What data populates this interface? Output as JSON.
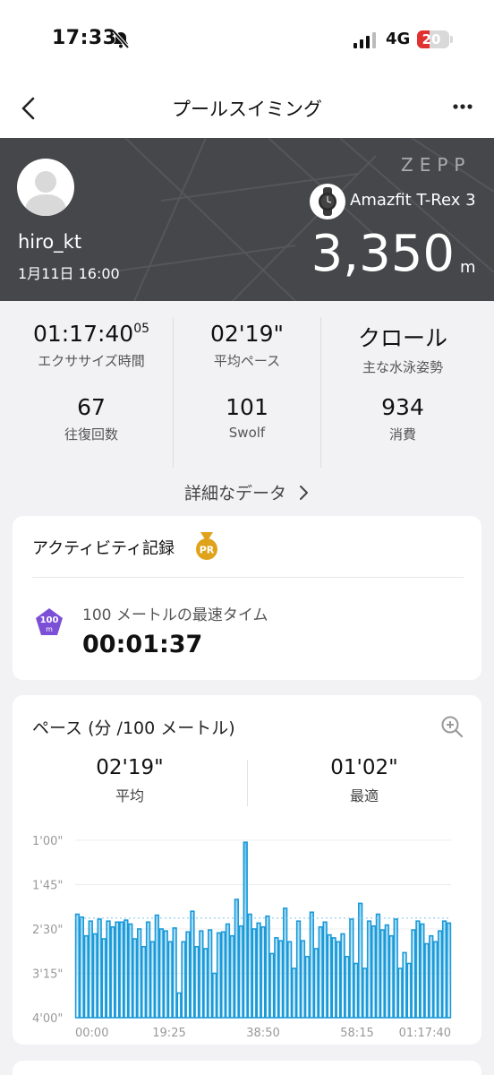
{
  "status_bar": {
    "time": "17:33",
    "network": "4G",
    "battery": "20",
    "icons": [
      "bell-slash-icon",
      "signal-icon"
    ]
  },
  "nav": {
    "title": "プールスイミング",
    "back_icon": "chevron-left-icon",
    "more_icon": "more-icon"
  },
  "hero": {
    "username": "hiro_kt",
    "datetime": "1月11日 16:00",
    "brand": "ZEPP",
    "device": "Amazfit T-Rex 3",
    "distance": "3,350",
    "distance_unit": "m"
  },
  "stats": [
    {
      "value": "01:17:40",
      "sup": "05",
      "label": "エクササイズ時間"
    },
    {
      "value": "02'19\"",
      "label": "平均ペース"
    },
    {
      "value": "クロール",
      "label": "主な水泳姿勢"
    },
    {
      "value": "67",
      "label": "往復回数"
    },
    {
      "value": "101",
      "label": "Swolf"
    },
    {
      "value": "934",
      "label": "消費"
    }
  ],
  "detail_link": "詳細なデータ",
  "activity_record": {
    "title": "アクティビティ記録",
    "badge": "PR",
    "item_badge": "100\nm",
    "item_label": "100 メートルの最速タイム",
    "item_value": "00:01:37"
  },
  "pace_card": {
    "title": "ペース (分 /100 メートル)",
    "summary": [
      {
        "value": "02'19\"",
        "label": "平均"
      },
      {
        "value": "01'02\"",
        "label": "最適"
      }
    ]
  },
  "colors": {
    "hero_bg": "#46474b",
    "accent_blue": "#1a9ad8",
    "pr_gold": "#e0a21a",
    "badge_purple": "#7b4fd6"
  },
  "chart_data": {
    "type": "bar",
    "y_axis_inverted": true,
    "y_ticks": [
      "1'00\"",
      "1'45\"",
      "2'30\"",
      "3'15\"",
      "4'00\""
    ],
    "y_range_seconds": [
      60,
      240
    ],
    "x_ticks": [
      "00:00",
      "19:25",
      "38:50",
      "58:15",
      "01:17:40"
    ],
    "avg_line_seconds": 139,
    "values_seconds": [
      135,
      138,
      157,
      142,
      155,
      140,
      160,
      142,
      148,
      143,
      143,
      141,
      145,
      160,
      150,
      168,
      143,
      163,
      136,
      150,
      152,
      163,
      149,
      215,
      163,
      153,
      132,
      168,
      152,
      170,
      151,
      195,
      154,
      153,
      145,
      157,
      120,
      147,
      62,
      135,
      150,
      144,
      148,
      137,
      175,
      159,
      162,
      129,
      163,
      190,
      142,
      162,
      178,
      133,
      170,
      148,
      143,
      156,
      159,
      163,
      155,
      178,
      140,
      185,
      124,
      190,
      142,
      147,
      135,
      151,
      146,
      157,
      140,
      190,
      174,
      185,
      151,
      142,
      145,
      165,
      157,
      163,
      152,
      142,
      144
    ]
  }
}
